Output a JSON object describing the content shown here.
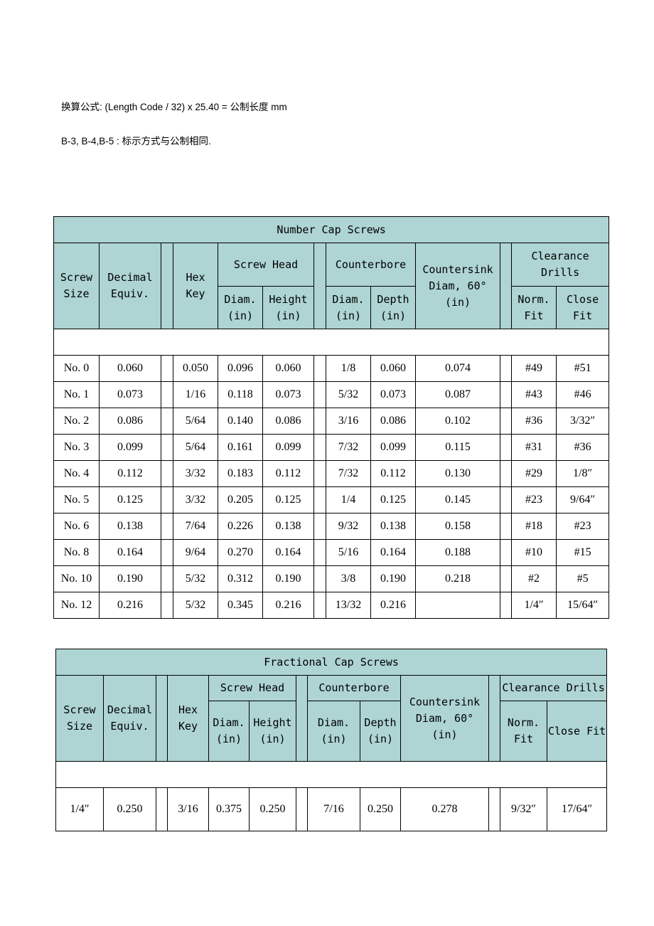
{
  "notes": {
    "formula": "换算公式: (Length Code / 32) x 25.40 =  公制长度 mm",
    "b_series": "B-3, B-4,B-5 :  标示方式与公制相同."
  },
  "number_cap_screws": {
    "title": "Number Cap Screws",
    "headers": {
      "screw_size": "Screw Size",
      "decimal_equiv": "Decimal Equiv.",
      "hex_key": "Hex Key",
      "screw_head": "Screw Head",
      "head_diam": "Diam. (in)",
      "head_height": "Height (in)",
      "counterbore": "Counterbore",
      "cb_diam": "Diam. (in)",
      "cb_depth": "Depth (in)",
      "countersink": "Countersink Diam, 60° (in)",
      "clearance_drills": "Clearance Drills",
      "norm_fit": "Norm. Fit",
      "close_fit": "Close Fit"
    },
    "rows": [
      [
        "No.  0",
        "0.060",
        "0.050",
        "0.096",
        "0.060",
        "1/8",
        "0.060",
        "0.074",
        "#49",
        "#51"
      ],
      [
        "No.  1",
        "0.073",
        "1/16",
        "0.118",
        "0.073",
        "5/32",
        "0.073",
        "0.087",
        "#43",
        "#46"
      ],
      [
        "No.  2",
        "0.086",
        "5/64",
        "0.140",
        "0.086",
        "3/16",
        "0.086",
        "0.102",
        "#36",
        "3/32″"
      ],
      [
        "No.  3",
        "0.099",
        "5/64",
        "0.161",
        "0.099",
        "7/32",
        "0.099",
        "0.115",
        "#31",
        "#36"
      ],
      [
        "No.  4",
        "0.112",
        "3/32",
        "0.183",
        "0.112",
        "7/32",
        "0.112",
        "0.130",
        "#29",
        "1/8″"
      ],
      [
        "No.  5",
        "0.125",
        "3/32",
        "0.205",
        "0.125",
        "1/4",
        "0.125",
        "0.145",
        "#23",
        "9/64″"
      ],
      [
        "No.  6",
        "0.138",
        "7/64",
        "0.226",
        "0.138",
        "9/32",
        "0.138",
        "0.158",
        "#18",
        "#23"
      ],
      [
        "No.  8",
        "0.164",
        "9/64",
        "0.270",
        "0.164",
        "5/16",
        "0.164",
        "0.188",
        "#10",
        "#15"
      ],
      [
        "No. 10",
        "0.190",
        "5/32",
        "0.312",
        "0.190",
        "3/8",
        "0.190",
        "0.218",
        "#2",
        "#5"
      ],
      [
        "No. 12",
        "0.216",
        "5/32",
        "0.345",
        "0.216",
        "13/32",
        "0.216",
        "",
        "1/4″",
        "15/64″"
      ]
    ]
  },
  "fractional_cap_screws": {
    "title": "Fractional Cap Screws",
    "headers": {
      "screw_size": "Screw Size",
      "decimal_equiv": "Decimal Equiv.",
      "hex_key": "Hex Key",
      "screw_head": "Screw Head",
      "head_diam": "Diam. (in)",
      "head_height": "Height (in)",
      "counterbore": "Counterbore",
      "cb_diam": "Diam. (in)",
      "cb_depth": "Depth (in)",
      "countersink": "Countersink Diam, 60° (in)",
      "clearance_drills": "Clearance Drills",
      "norm_fit": "Norm. Fit",
      "close_fit": "Close Fit"
    },
    "rows": [
      [
        "1/4″",
        "0.250",
        "3/16",
        "0.375",
        "0.250",
        "7/16",
        "0.250",
        "0.278",
        "9/32″",
        "17/64″"
      ]
    ]
  }
}
